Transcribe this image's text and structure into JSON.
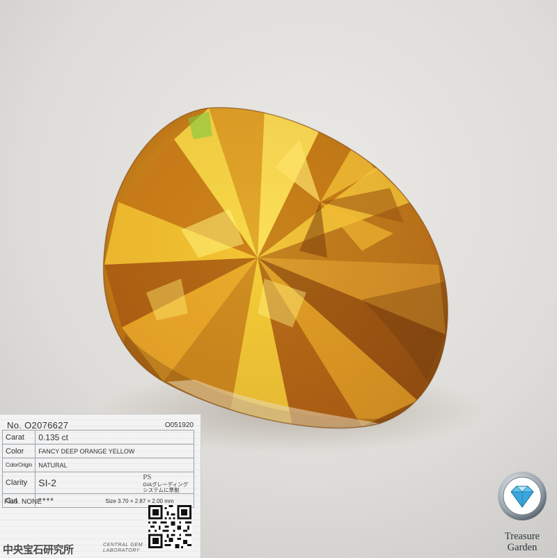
{
  "report": {
    "no_label": "No.",
    "no_value": "O2076627",
    "code2": "O051920",
    "rows": {
      "carat_label": "Carat",
      "carat_value": "0.135 ct",
      "color_label": "Color",
      "color_value": "FANCY DEEP ORANGE YELLOW",
      "origin_label": "ColorOrigin",
      "origin_value": "NATURAL",
      "clarity_label": "Clarity",
      "clarity_value": "SI-2",
      "ps": "PS",
      "gia_line1": "GIAグレーディング",
      "gia_line2": "システムに準拠",
      "cut_label": "Cut",
      "cut_value": "****",
      "size": "Size 3.70 × 2.87 × 2.00 mm"
    },
    "fluo": "Fluo. NONE",
    "lab_jp": "中央宝石研究所",
    "lab_en_line1": "CENTRAL GEM",
    "lab_en_line2": "LABORATORY"
  },
  "brand": {
    "line1": "Treasure",
    "line2": "Garden"
  },
  "colors": {
    "background": "#d9d7d3",
    "gem_amber": "#c8871a",
    "gem_yellow": "#f5d23a",
    "gem_dark": "#6b3a0e",
    "brand_text": "#2a3740",
    "logo_diamond": "#5fc4ee"
  }
}
